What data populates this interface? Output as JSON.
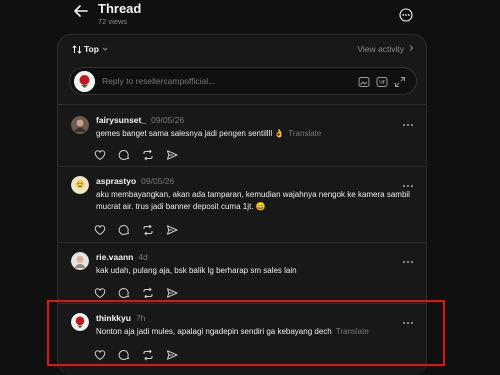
{
  "header": {
    "title": "Thread",
    "views": "72 views"
  },
  "sort": {
    "label": "Top",
    "activity_label": "View activity"
  },
  "reply": {
    "placeholder": "Reply to resellercampofficial..."
  },
  "comments": [
    {
      "username": "fairysunset_",
      "time": "09/05/26",
      "text": "gemes banget sama salesnya jadi pengen sentillll 👌",
      "translate": "Translate"
    },
    {
      "username": "asprastyo",
      "time": "09/05/26",
      "text": "aku membayangkan, akan ada tamparan, kemudian wajahnya nengok ke kamera sambil mucrat air. trus jadi banner deposit cuma 1jt. 😄",
      "translate": ""
    },
    {
      "username": "rie.vaann",
      "time": "4d",
      "text": "kak udah, pulang aja, bsk balik lg berharap sm sales lain",
      "translate": ""
    },
    {
      "username": "thinkkyu",
      "time": "7h",
      "text": "Nonton aja jadi mules, apalagi ngadepin sendiri ga kebayang dech",
      "translate": "Translate"
    }
  ],
  "colors": {
    "background": "#101010",
    "panel": "#181818",
    "highlight": "#e01414",
    "muted": "#777777"
  }
}
